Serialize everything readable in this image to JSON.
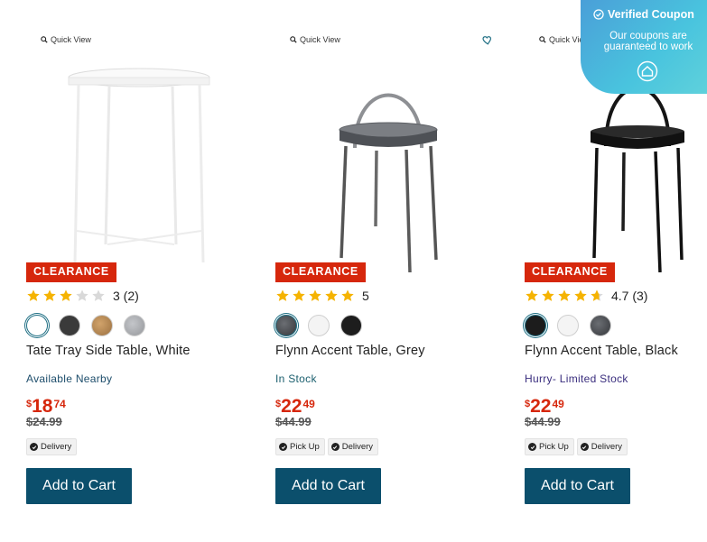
{
  "coupon": {
    "title": "Verified Coupon",
    "line1": "Our coupons are",
    "line2": "guaranteed to work"
  },
  "colors": {
    "clearance": "#d6270c",
    "button": "#0b4f6c",
    "star": "#f5b301",
    "price": "#d6270c"
  },
  "products": [
    {
      "quick_view": "Quick View",
      "badge": "CLEARANCE",
      "rating_stars": 3,
      "rating_text": "3 (2)",
      "swatch_colors": [
        "#ffffff",
        "#3a3a3a",
        "#b58a55",
        "#a7a9ad"
      ],
      "title": "Tate Tray Side Table, White",
      "stock": "Available Nearby",
      "price_currency": "$",
      "price_dollars": "18",
      "price_cents": "74",
      "was_price": "$24.99",
      "tags": [
        "Delivery"
      ],
      "button": "Add to Cart"
    },
    {
      "quick_view": "Quick View",
      "badge": "CLEARANCE",
      "rating_stars": 5,
      "rating_text": "5",
      "swatch_colors": [
        "#4a4d52",
        "#f4f4f4",
        "#1d1d1d"
      ],
      "title": "Flynn Accent Table, Grey",
      "stock": "In Stock",
      "price_currency": "$",
      "price_dollars": "22",
      "price_cents": "49",
      "was_price": "$44.99",
      "tags": [
        "Pick Up",
        "Delivery"
      ],
      "button": "Add to Cart"
    },
    {
      "quick_view": "Quick View",
      "badge": "CLEARANCE",
      "rating_stars": 4.7,
      "rating_text": "4.7 (3)",
      "swatch_colors": [
        "#1c1c1c",
        "#f4f4f4",
        "#4a4d52"
      ],
      "title": "Flynn Accent Table, Black",
      "stock": "Hurry- Limited Stock",
      "price_currency": "$",
      "price_dollars": "22",
      "price_cents": "49",
      "was_price": "$44.99",
      "tags": [
        "Pick Up",
        "Delivery"
      ],
      "button": "Add to Cart"
    }
  ]
}
